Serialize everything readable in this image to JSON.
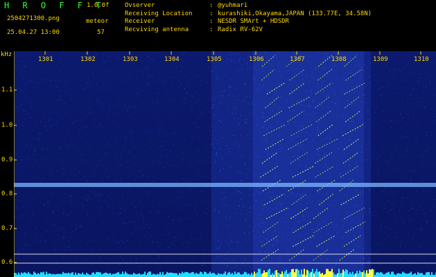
{
  "header": {
    "logo": "H R O F F T",
    "version": "1.0.0f",
    "filename": "2504271300.png",
    "meteor_label": "meteor",
    "datetime": "25.04.27 13:00",
    "count": "57"
  },
  "metadata": [
    {
      "key": "Ovserver",
      "value": "@yuhmari"
    },
    {
      "key": "Receiving Location",
      "value": "kurashiki,Okayama,JAPAN (133.77E, 34.58N)"
    },
    {
      "key": "Receiver",
      "value": "NESDR SMArt + HDSDR"
    },
    {
      "key": "Recviving antenna",
      "value": "Radix RV-62V"
    }
  ],
  "axis": {
    "unit": "kHz",
    "x_ticks": [
      "1301",
      "1302",
      "1303",
      "1304",
      "1305",
      "1306",
      "1307",
      "1308",
      "1309",
      "1310"
    ],
    "y_ticks": [
      "1.1",
      "1.0",
      "0.9",
      "0.8",
      "0.7",
      "0.6"
    ]
  },
  "colors": {
    "background": "#0a1660",
    "label": "#ffd700",
    "logo": "#32ff32",
    "carrier": "#8fc8ff",
    "signal": "#c8ff60",
    "floor": "#22ddff"
  }
}
